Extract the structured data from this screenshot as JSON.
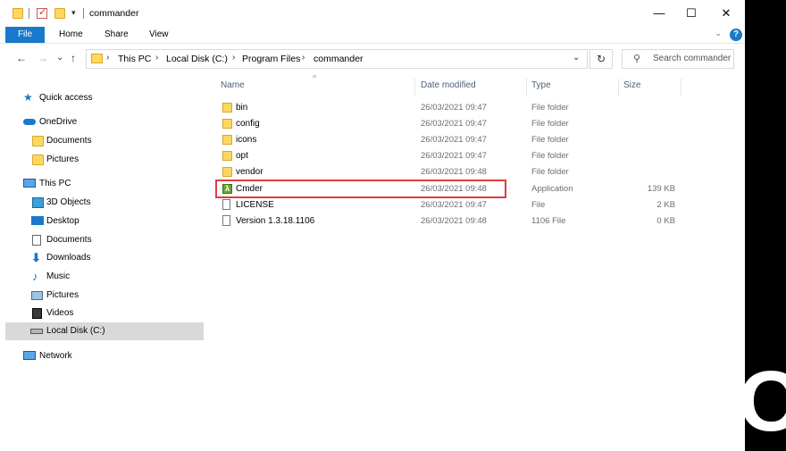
{
  "window": {
    "title": "commander",
    "min_label": "—",
    "max_label": "☐",
    "close_label": "✕"
  },
  "ribbon": {
    "tabs": [
      "File",
      "Home",
      "Share",
      "View"
    ],
    "help_label": "?",
    "collapse_label": "⌄"
  },
  "address": {
    "back_label": "←",
    "forward_label": "→",
    "recent_label": "⌄",
    "up_label": "↑",
    "crumbs": [
      "This PC",
      "Local Disk (C:)",
      "Program Files",
      "commander"
    ],
    "sep": "›",
    "dropdown_label": "⌄",
    "refresh_label": "↻",
    "search_placeholder": "Search commander",
    "search_icon": "⚲"
  },
  "nav": {
    "items": [
      {
        "label": "Quick access",
        "icon": "star-icon"
      },
      {
        "label": "OneDrive",
        "icon": "cloud-icon"
      },
      {
        "label": "Documents",
        "icon": "folder-icon"
      },
      {
        "label": "Pictures",
        "icon": "folder-icon"
      },
      {
        "label": "This PC",
        "icon": "monitor-icon"
      },
      {
        "label": "3D Objects",
        "icon": "cube-icon"
      },
      {
        "label": "Desktop",
        "icon": "desktop-icon"
      },
      {
        "label": "Documents",
        "icon": "documents-icon"
      },
      {
        "label": "Downloads",
        "icon": "download-icon"
      },
      {
        "label": "Music",
        "icon": "music-icon"
      },
      {
        "label": "Pictures",
        "icon": "pictures-icon"
      },
      {
        "label": "Videos",
        "icon": "videos-icon"
      },
      {
        "label": "Local Disk (C:)",
        "icon": "drive-icon"
      },
      {
        "label": "Network",
        "icon": "network-icon"
      }
    ],
    "selected_index": 12
  },
  "files": {
    "columns": [
      "Name",
      "Date modified",
      "Type",
      "Size"
    ],
    "sort_caret": "^",
    "rows": [
      {
        "name": "bin",
        "date": "26/03/2021 09:47",
        "type": "File folder",
        "size": "",
        "icon": "folder-icon"
      },
      {
        "name": "config",
        "date": "26/03/2021 09:47",
        "type": "File folder",
        "size": "",
        "icon": "folder-icon"
      },
      {
        "name": "icons",
        "date": "26/03/2021 09:47",
        "type": "File folder",
        "size": "",
        "icon": "folder-icon"
      },
      {
        "name": "opt",
        "date": "26/03/2021 09:47",
        "type": "File folder",
        "size": "",
        "icon": "folder-icon"
      },
      {
        "name": "vendor",
        "date": "26/03/2021 09:48",
        "type": "File folder",
        "size": "",
        "icon": "folder-icon"
      },
      {
        "name": "Cmder",
        "date": "26/03/2021 09:48",
        "type": "Application",
        "size": "139 KB",
        "icon": "cmder-icon"
      },
      {
        "name": "LICENSE",
        "date": "26/03/2021 09:47",
        "type": "File",
        "size": "2 KB",
        "icon": "document-icon"
      },
      {
        "name": "Version 1.3.18.1106",
        "date": "26/03/2021 09:48",
        "type": "1106 File",
        "size": "0 KB",
        "icon": "document-icon"
      }
    ],
    "highlighted_row": "Cmder"
  },
  "background": {
    "glyph": "O"
  },
  "colors": {
    "accent": "#1979ca",
    "highlight_border": "#e23b3b",
    "selected_nav": "#d9d9d9"
  }
}
